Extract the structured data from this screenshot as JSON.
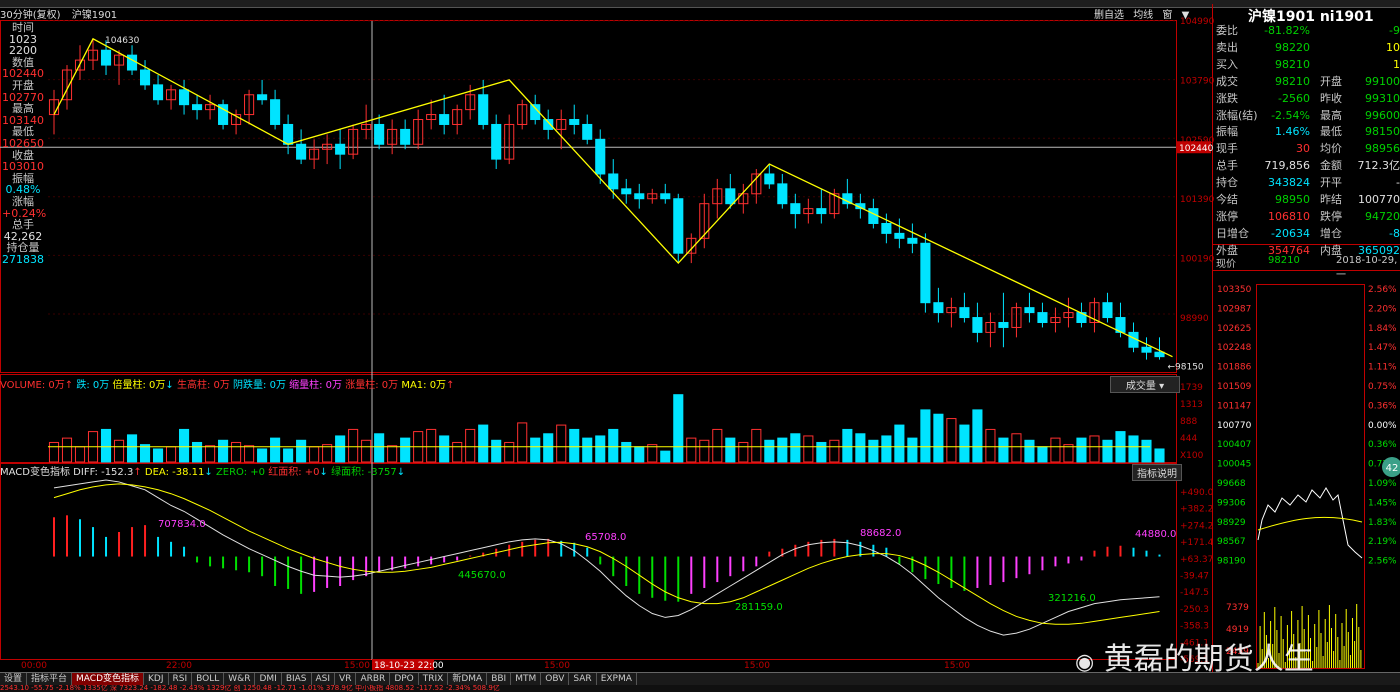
{
  "header": {
    "period": "30分钟(复权)",
    "symbol": "沪镍1901",
    "links": [
      "删自选",
      "均线",
      "窗",
      "▼"
    ]
  },
  "infobox": [
    {
      "label": "时间",
      "value": "1023",
      "cls": "wht"
    },
    {
      "label": "",
      "value": "2200",
      "cls": "wht"
    },
    {
      "label": "数值",
      "value": "102440",
      "cls": "red"
    },
    {
      "label": "开盘",
      "value": "102770",
      "cls": "red"
    },
    {
      "label": "最高",
      "value": "103140",
      "cls": "red"
    },
    {
      "label": "最低",
      "value": "102650",
      "cls": "red"
    },
    {
      "label": "收盘",
      "value": "103010",
      "cls": "red"
    },
    {
      "label": "振幅",
      "value": "0.48%",
      "cls": "cyan"
    },
    {
      "label": "涨幅",
      "value": "+0.24%",
      "cls": "red"
    },
    {
      "label": "总手",
      "value": "42,262",
      "cls": "wht"
    },
    {
      "label": "持仓量",
      "value": "271838",
      "cls": "cyan"
    }
  ],
  "quote": {
    "title": "沪镍1901 ni1901",
    "rows": [
      {
        "l1": "委比",
        "v1": "-81.82%",
        "c1": "grn",
        "l2": "",
        "v2": "-9",
        "c2": "grn"
      },
      {
        "l1": "卖出",
        "v1": "98220",
        "c1": "grn",
        "l2": "",
        "v2": "10",
        "c2": "yel"
      },
      {
        "l1": "买入",
        "v1": "98210",
        "c1": "grn",
        "l2": "",
        "v2": "1",
        "c2": "yel"
      },
      {
        "l1": "成交",
        "v1": "98210",
        "c1": "grn",
        "l2": "开盘",
        "v2": "99100",
        "c2": "grn"
      },
      {
        "l1": "涨跌",
        "v1": "-2560",
        "c1": "grn",
        "l2": "昨收",
        "v2": "99310",
        "c2": "grn"
      },
      {
        "l1": "涨幅(结)",
        "v1": "-2.54%",
        "c1": "grn",
        "l2": "最高",
        "v2": "99600",
        "c2": "grn"
      },
      {
        "l1": "振幅",
        "v1": "1.46%",
        "c1": "cyan",
        "l2": "最低",
        "v2": "98150",
        "c2": "grn"
      },
      {
        "l1": "现手",
        "v1": "30",
        "c1": "red",
        "l2": "均价",
        "v2": "98956",
        "c2": "grn"
      },
      {
        "l1": "总手",
        "v1": "719,856",
        "c1": "wht",
        "l2": "金额",
        "v2": "712.3亿",
        "c2": "wht"
      },
      {
        "l1": "持仓",
        "v1": "343824",
        "c1": "cyan",
        "l2": "开平",
        "v2": "-",
        "c2": "wht"
      },
      {
        "l1": "今结",
        "v1": "98950",
        "c1": "grn",
        "l2": "昨结",
        "v2": "100770",
        "c2": "wht"
      },
      {
        "l1": "涨停",
        "v1": "106810",
        "c1": "red",
        "l2": "跌停",
        "v2": "94720",
        "c2": "grn"
      },
      {
        "l1": "日增仓",
        "v1": "-20634",
        "c1": "cyan",
        "l2": "增仓",
        "v2": "-8",
        "c2": "cyan"
      },
      {
        "l1": "外盘",
        "v1": "354764",
        "c1": "red",
        "l2": "内盘",
        "v2": "365092",
        "c2": "cyan"
      }
    ]
  },
  "mini": {
    "label": "现价",
    "price": "98210",
    "date": "2018-10-29,一",
    "left_ticks": [
      "103350",
      "102987",
      "102625",
      "102248",
      "101886",
      "101509",
      "101147",
      "100770",
      "100407",
      "100045",
      "99668",
      "99306",
      "98929",
      "98567",
      "98190"
    ],
    "right_ticks": [
      "2.56%",
      "2.20%",
      "1.84%",
      "1.47%",
      "1.11%",
      "0.75%",
      "0.36%",
      "0.00%",
      "0.36%",
      "0.72%",
      "1.09%",
      "1.45%",
      "1.83%",
      "2.19%",
      "2.56%"
    ],
    "vol_ticks": [
      "7379",
      "4919",
      "2459"
    ],
    "badge": "42"
  },
  "volume_legend": [
    {
      "text": "VOLUME: 0万",
      "cls": "red"
    },
    {
      "text": "↑",
      "cls": "red"
    },
    {
      "text": " 跌: 0万",
      "cls": "cyan"
    },
    {
      "text": " 倍量柱: 0万",
      "cls": "yel"
    },
    {
      "text": "↓",
      "cls": "cyan"
    },
    {
      "text": " 生高柱: 0万",
      "cls": "red"
    },
    {
      "text": " 阴跌量: 0万",
      "cls": "cyan"
    },
    {
      "text": " 缩量柱: 0万",
      "cls": "mag"
    },
    {
      "text": " 涨量柱: 0万",
      "cls": "red"
    },
    {
      "text": " MA1: 0万",
      "cls": "yel"
    },
    {
      "text": "↑",
      "cls": "red"
    }
  ],
  "volume_button": "成交量",
  "macd_legend": [
    {
      "text": "MACD变色指标",
      "cls": "wht"
    },
    {
      "text": " DIFF: -152.3",
      "cls": "wht"
    },
    {
      "text": "↑",
      "cls": "red"
    },
    {
      "text": " DEA: -38.11",
      "cls": "yel"
    },
    {
      "text": "↓",
      "cls": "cyan"
    },
    {
      "text": " ZERO: +0",
      "cls": "grn"
    },
    {
      "text": " 红面积: +0",
      "cls": "red"
    },
    {
      "text": "↓",
      "cls": "cyan"
    },
    {
      "text": " 绿面积: -3757",
      "cls": "grn"
    },
    {
      "text": "↓",
      "cls": "cyan"
    }
  ],
  "macd_button": "指标说明",
  "bottom_tabs": [
    "设置",
    "指标平台",
    "MACD变色指标",
    "KDJ",
    "RSI",
    "BOLL",
    "W&R",
    "DMI",
    "BIAS",
    "ASI",
    "VR",
    "ARBR",
    "DPO",
    "TRIX",
    "新DMA",
    "BBI",
    "MTM",
    "OBV",
    "SAR",
    "EXPMA"
  ],
  "status_text": "2543.10  -55.75  -2.18%  1335亿  深  7323.24  -182.48  -2.43%  1329亿  创  1250.48  -12.71  -1.01%  378.9亿  中小板指  4808.52  -117.52  -2.34%  508.9亿",
  "watermark": "黄磊的期货人生",
  "chart_data": [
    {
      "type": "candlestick",
      "title": "沪镍1901 30分钟(复权)",
      "y_ticks": [
        104990,
        103790,
        102590,
        101390,
        100190,
        98990
      ],
      "ylim": [
        97900,
        104990
      ],
      "x_labels": [
        "00:00",
        "22:00",
        "15:00",
        "15:00",
        "15:00",
        "15:00"
      ],
      "crosshair": {
        "time": "18-10-23 22:00",
        "value": 102440
      },
      "annotations": [
        {
          "text": "104630"
        },
        {
          "text": "98150"
        }
      ],
      "candles": [
        [
          103100,
          103600,
          102700,
          103400
        ],
        [
          103400,
          104100,
          103200,
          104000
        ],
        [
          104000,
          104500,
          103800,
          104200
        ],
        [
          104200,
          104630,
          104000,
          104400
        ],
        [
          104400,
          104600,
          103900,
          104100
        ],
        [
          104100,
          104400,
          103700,
          104300
        ],
        [
          104300,
          104500,
          103900,
          104000
        ],
        [
          104000,
          104200,
          103600,
          103700
        ],
        [
          103700,
          103900,
          103300,
          103400
        ],
        [
          103400,
          103700,
          103200,
          103600
        ],
        [
          103600,
          103800,
          103100,
          103300
        ],
        [
          103300,
          103500,
          103000,
          103200
        ],
        [
          103200,
          103500,
          103000,
          103300
        ],
        [
          103300,
          103400,
          102800,
          102900
        ],
        [
          102900,
          103200,
          102700,
          103100
        ],
        [
          103100,
          103600,
          102900,
          103500
        ],
        [
          103500,
          103800,
          103300,
          103400
        ],
        [
          103400,
          103600,
          102800,
          102900
        ],
        [
          102900,
          103100,
          102300,
          102500
        ],
        [
          102500,
          102800,
          102100,
          102200
        ],
        [
          102200,
          102600,
          102000,
          102400
        ],
        [
          102400,
          102700,
          102100,
          102500
        ],
        [
          102500,
          102800,
          102000,
          102300
        ],
        [
          102300,
          102900,
          102200,
          102800
        ],
        [
          102800,
          103300,
          102600,
          102900
        ],
        [
          102900,
          103100,
          102400,
          102500
        ],
        [
          102500,
          103000,
          102300,
          102800
        ],
        [
          102800,
          103000,
          102400,
          102500
        ],
        [
          102500,
          103200,
          102400,
          103000
        ],
        [
          103000,
          103400,
          102800,
          103100
        ],
        [
          103100,
          103500,
          102700,
          102900
        ],
        [
          102900,
          103300,
          102700,
          103200
        ],
        [
          103200,
          103700,
          103000,
          103500
        ],
        [
          103500,
          103800,
          102800,
          102900
        ],
        [
          102900,
          103100,
          102000,
          102200
        ],
        [
          102200,
          103100,
          102100,
          102900
        ],
        [
          102900,
          103400,
          102800,
          103300
        ],
        [
          103300,
          103500,
          102900,
          103000
        ],
        [
          103000,
          103200,
          102600,
          102800
        ],
        [
          102800,
          103200,
          102400,
          103000
        ],
        [
          103000,
          103300,
          102700,
          102900
        ],
        [
          102900,
          103100,
          102500,
          102600
        ],
        [
          102600,
          102800,
          101700,
          101900
        ],
        [
          101900,
          102200,
          101400,
          101600
        ],
        [
          101600,
          101800,
          101300,
          101500
        ],
        [
          101500,
          101700,
          101200,
          101400
        ],
        [
          101400,
          101600,
          101300,
          101500
        ],
        [
          101500,
          101700,
          101300,
          101400
        ],
        [
          101400,
          101500,
          100100,
          100300
        ],
        [
          100300,
          100700,
          100100,
          100600
        ],
        [
          100600,
          101500,
          100400,
          101300
        ],
        [
          101300,
          101800,
          101000,
          101600
        ],
        [
          101600,
          101900,
          101200,
          101300
        ],
        [
          101300,
          101700,
          101100,
          101500
        ],
        [
          101500,
          102000,
          101300,
          101900
        ],
        [
          101900,
          102100,
          101600,
          101700
        ],
        [
          101700,
          101900,
          101200,
          101300
        ],
        [
          101300,
          101500,
          100800,
          101100
        ],
        [
          101100,
          101400,
          100900,
          101200
        ],
        [
          101200,
          101600,
          100900,
          101100
        ],
        [
          101100,
          101600,
          101000,
          101500
        ],
        [
          101500,
          101800,
          101200,
          101300
        ],
        [
          101300,
          101500,
          101000,
          101200
        ],
        [
          101200,
          101400,
          100800,
          100900
        ],
        [
          100900,
          101100,
          100500,
          100700
        ],
        [
          100700,
          101000,
          100400,
          100600
        ],
        [
          100600,
          100900,
          100300,
          100500
        ],
        [
          100500,
          100700,
          99100,
          99300
        ],
        [
          99300,
          99600,
          98900,
          99100
        ],
        [
          99100,
          99400,
          98800,
          99200
        ],
        [
          99200,
          99500,
          98900,
          99000
        ],
        [
          99000,
          99300,
          98500,
          98700
        ],
        [
          98700,
          99100,
          98400,
          98900
        ],
        [
          98900,
          99500,
          98400,
          98800
        ],
        [
          98800,
          99300,
          98600,
          99200
        ],
        [
          99200,
          99500,
          98900,
          99100
        ],
        [
          99100,
          99300,
          98800,
          98900
        ],
        [
          98900,
          99200,
          98700,
          99000
        ],
        [
          99000,
          99400,
          98800,
          99100
        ],
        [
          99100,
          99300,
          98800,
          98900
        ],
        [
          98900,
          99400,
          98700,
          99300
        ],
        [
          99300,
          99500,
          98900,
          99000
        ],
        [
          99000,
          99300,
          98600,
          98700
        ],
        [
          98700,
          98900,
          98300,
          98400
        ],
        [
          98400,
          98600,
          98150,
          98300
        ],
        [
          98300,
          98600,
          98150,
          98210
        ]
      ],
      "volume": [
        18,
        22,
        14,
        28,
        30,
        20,
        25,
        16,
        12,
        14,
        30,
        18,
        15,
        20,
        18,
        15,
        12,
        22,
        12,
        20,
        14,
        16,
        24,
        30,
        20,
        26,
        15,
        22,
        28,
        30,
        24,
        18,
        30,
        34,
        20,
        18,
        36,
        22,
        26,
        34,
        30,
        22,
        24,
        30,
        18,
        14,
        16,
        10,
        62,
        22,
        20,
        30,
        22,
        18,
        30,
        20,
        22,
        26,
        24,
        18,
        20,
        30,
        26,
        20,
        24,
        34,
        22,
        48,
        44,
        40,
        34,
        48,
        30,
        22,
        26,
        20,
        14,
        22,
        16,
        22,
        24,
        20,
        28,
        24,
        20,
        12
      ],
      "macd_hist": [
        400,
        420,
        380,
        300,
        200,
        250,
        300,
        320,
        200,
        150,
        100,
        -60,
        -100,
        -120,
        -140,
        -160,
        -200,
        -300,
        -330,
        -380,
        -360,
        -320,
        -300,
        -240,
        -200,
        -160,
        -140,
        -120,
        -100,
        -80,
        -60,
        -40,
        10,
        40,
        80,
        120,
        150,
        170,
        180,
        160,
        140,
        90,
        -80,
        -200,
        -300,
        -380,
        -420,
        -450,
        -460,
        -380,
        -320,
        -260,
        -200,
        -150,
        -100,
        50,
        80,
        120,
        150,
        170,
        180,
        170,
        150,
        120,
        90,
        -80,
        -160,
        -230,
        -280,
        -320,
        -350,
        -320,
        -290,
        -260,
        -220,
        -180,
        -140,
        -100,
        -70,
        -40,
        60,
        100,
        110,
        90,
        60,
        20
      ],
      "macd_diff": [
        700,
        720,
        740,
        760,
        780,
        760,
        720,
        680,
        600,
        520,
        460,
        380,
        300,
        220,
        150,
        80,
        20,
        -40,
        -100,
        -150,
        -190,
        -200,
        -210,
        -200,
        -180,
        -150,
        -120,
        -90,
        -60,
        -30,
        0,
        30,
        60,
        90,
        120,
        150,
        170,
        180,
        170,
        130,
        60,
        -40,
        -150,
        -280,
        -400,
        -500,
        -580,
        -620,
        -600,
        -540,
        -460,
        -380,
        -300,
        -220,
        -140,
        -60,
        20,
        80,
        120,
        140,
        150,
        140,
        110,
        60,
        0,
        -80,
        -180,
        -300,
        -420,
        -520,
        -620,
        -700,
        -760,
        -800,
        -780,
        -740,
        -680,
        -620,
        -560,
        -520,
        -480,
        -460,
        -440,
        -430,
        -420,
        -410
      ],
      "macd_dea": [
        600,
        640,
        680,
        710,
        730,
        740,
        730,
        710,
        680,
        640,
        590,
        530,
        470,
        400,
        330,
        260,
        200,
        140,
        80,
        30,
        -20,
        -60,
        -100,
        -130,
        -150,
        -160,
        -160,
        -150,
        -130,
        -110,
        -80,
        -50,
        -20,
        10,
        40,
        70,
        100,
        120,
        140,
        145,
        130,
        100,
        50,
        -20,
        -100,
        -190,
        -280,
        -360,
        -420,
        -460,
        -480,
        -480,
        -460,
        -420,
        -360,
        -300,
        -240,
        -180,
        -120,
        -70,
        -30,
        0,
        20,
        30,
        30,
        10,
        -30,
        -90,
        -160,
        -240,
        -320,
        -400,
        -480,
        -550,
        -610,
        -650,
        -680,
        -690,
        -690,
        -680,
        -660,
        -640,
        -620,
        -600,
        -580,
        -560
      ],
      "macd_ticks": [
        "+490.0",
        "+382.2",
        "+274.2",
        "+171.4",
        "+63.37",
        "-39.47",
        "-147.5",
        "-250.3",
        "-358.3",
        "-461.1",
        "-569.1"
      ],
      "macd_labels": [
        {
          "text": "707834.0"
        },
        {
          "text": "445670.0"
        },
        {
          "text": "65708.0"
        },
        {
          "text": "281159.0"
        },
        {
          "text": "88682.0"
        },
        {
          "text": "321216.0"
        },
        {
          "text": "44880.0"
        }
      ],
      "volume_ticks": [
        "1739",
        "1313",
        "888",
        "444",
        "X100"
      ]
    }
  ]
}
